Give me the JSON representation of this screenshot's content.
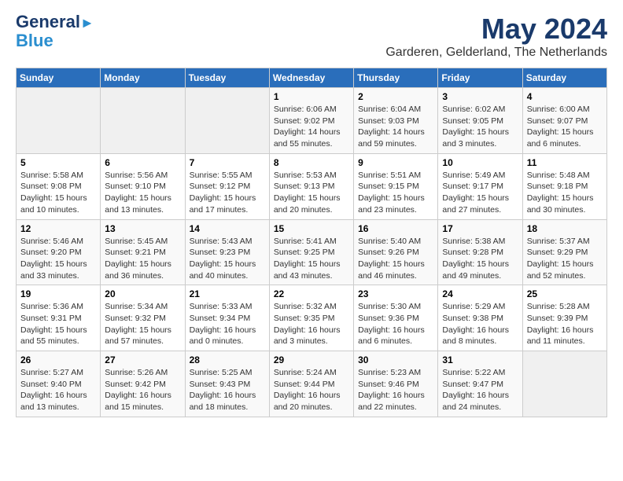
{
  "header": {
    "logo_line1": "General",
    "logo_line2": "Blue",
    "title": "May 2024",
    "subtitle": "Garderen, Gelderland, The Netherlands"
  },
  "weekdays": [
    "Sunday",
    "Monday",
    "Tuesday",
    "Wednesday",
    "Thursday",
    "Friday",
    "Saturday"
  ],
  "weeks": [
    [
      {
        "day": "",
        "info": ""
      },
      {
        "day": "",
        "info": ""
      },
      {
        "day": "",
        "info": ""
      },
      {
        "day": "1",
        "info": "Sunrise: 6:06 AM\nSunset: 9:02 PM\nDaylight: 14 hours\nand 55 minutes."
      },
      {
        "day": "2",
        "info": "Sunrise: 6:04 AM\nSunset: 9:03 PM\nDaylight: 14 hours\nand 59 minutes."
      },
      {
        "day": "3",
        "info": "Sunrise: 6:02 AM\nSunset: 9:05 PM\nDaylight: 15 hours\nand 3 minutes."
      },
      {
        "day": "4",
        "info": "Sunrise: 6:00 AM\nSunset: 9:07 PM\nDaylight: 15 hours\nand 6 minutes."
      }
    ],
    [
      {
        "day": "5",
        "info": "Sunrise: 5:58 AM\nSunset: 9:08 PM\nDaylight: 15 hours\nand 10 minutes."
      },
      {
        "day": "6",
        "info": "Sunrise: 5:56 AM\nSunset: 9:10 PM\nDaylight: 15 hours\nand 13 minutes."
      },
      {
        "day": "7",
        "info": "Sunrise: 5:55 AM\nSunset: 9:12 PM\nDaylight: 15 hours\nand 17 minutes."
      },
      {
        "day": "8",
        "info": "Sunrise: 5:53 AM\nSunset: 9:13 PM\nDaylight: 15 hours\nand 20 minutes."
      },
      {
        "day": "9",
        "info": "Sunrise: 5:51 AM\nSunset: 9:15 PM\nDaylight: 15 hours\nand 23 minutes."
      },
      {
        "day": "10",
        "info": "Sunrise: 5:49 AM\nSunset: 9:17 PM\nDaylight: 15 hours\nand 27 minutes."
      },
      {
        "day": "11",
        "info": "Sunrise: 5:48 AM\nSunset: 9:18 PM\nDaylight: 15 hours\nand 30 minutes."
      }
    ],
    [
      {
        "day": "12",
        "info": "Sunrise: 5:46 AM\nSunset: 9:20 PM\nDaylight: 15 hours\nand 33 minutes."
      },
      {
        "day": "13",
        "info": "Sunrise: 5:45 AM\nSunset: 9:21 PM\nDaylight: 15 hours\nand 36 minutes."
      },
      {
        "day": "14",
        "info": "Sunrise: 5:43 AM\nSunset: 9:23 PM\nDaylight: 15 hours\nand 40 minutes."
      },
      {
        "day": "15",
        "info": "Sunrise: 5:41 AM\nSunset: 9:25 PM\nDaylight: 15 hours\nand 43 minutes."
      },
      {
        "day": "16",
        "info": "Sunrise: 5:40 AM\nSunset: 9:26 PM\nDaylight: 15 hours\nand 46 minutes."
      },
      {
        "day": "17",
        "info": "Sunrise: 5:38 AM\nSunset: 9:28 PM\nDaylight: 15 hours\nand 49 minutes."
      },
      {
        "day": "18",
        "info": "Sunrise: 5:37 AM\nSunset: 9:29 PM\nDaylight: 15 hours\nand 52 minutes."
      }
    ],
    [
      {
        "day": "19",
        "info": "Sunrise: 5:36 AM\nSunset: 9:31 PM\nDaylight: 15 hours\nand 55 minutes."
      },
      {
        "day": "20",
        "info": "Sunrise: 5:34 AM\nSunset: 9:32 PM\nDaylight: 15 hours\nand 57 minutes."
      },
      {
        "day": "21",
        "info": "Sunrise: 5:33 AM\nSunset: 9:34 PM\nDaylight: 16 hours\nand 0 minutes."
      },
      {
        "day": "22",
        "info": "Sunrise: 5:32 AM\nSunset: 9:35 PM\nDaylight: 16 hours\nand 3 minutes."
      },
      {
        "day": "23",
        "info": "Sunrise: 5:30 AM\nSunset: 9:36 PM\nDaylight: 16 hours\nand 6 minutes."
      },
      {
        "day": "24",
        "info": "Sunrise: 5:29 AM\nSunset: 9:38 PM\nDaylight: 16 hours\nand 8 minutes."
      },
      {
        "day": "25",
        "info": "Sunrise: 5:28 AM\nSunset: 9:39 PM\nDaylight: 16 hours\nand 11 minutes."
      }
    ],
    [
      {
        "day": "26",
        "info": "Sunrise: 5:27 AM\nSunset: 9:40 PM\nDaylight: 16 hours\nand 13 minutes."
      },
      {
        "day": "27",
        "info": "Sunrise: 5:26 AM\nSunset: 9:42 PM\nDaylight: 16 hours\nand 15 minutes."
      },
      {
        "day": "28",
        "info": "Sunrise: 5:25 AM\nSunset: 9:43 PM\nDaylight: 16 hours\nand 18 minutes."
      },
      {
        "day": "29",
        "info": "Sunrise: 5:24 AM\nSunset: 9:44 PM\nDaylight: 16 hours\nand 20 minutes."
      },
      {
        "day": "30",
        "info": "Sunrise: 5:23 AM\nSunset: 9:46 PM\nDaylight: 16 hours\nand 22 minutes."
      },
      {
        "day": "31",
        "info": "Sunrise: 5:22 AM\nSunset: 9:47 PM\nDaylight: 16 hours\nand 24 minutes."
      },
      {
        "day": "",
        "info": ""
      }
    ]
  ]
}
